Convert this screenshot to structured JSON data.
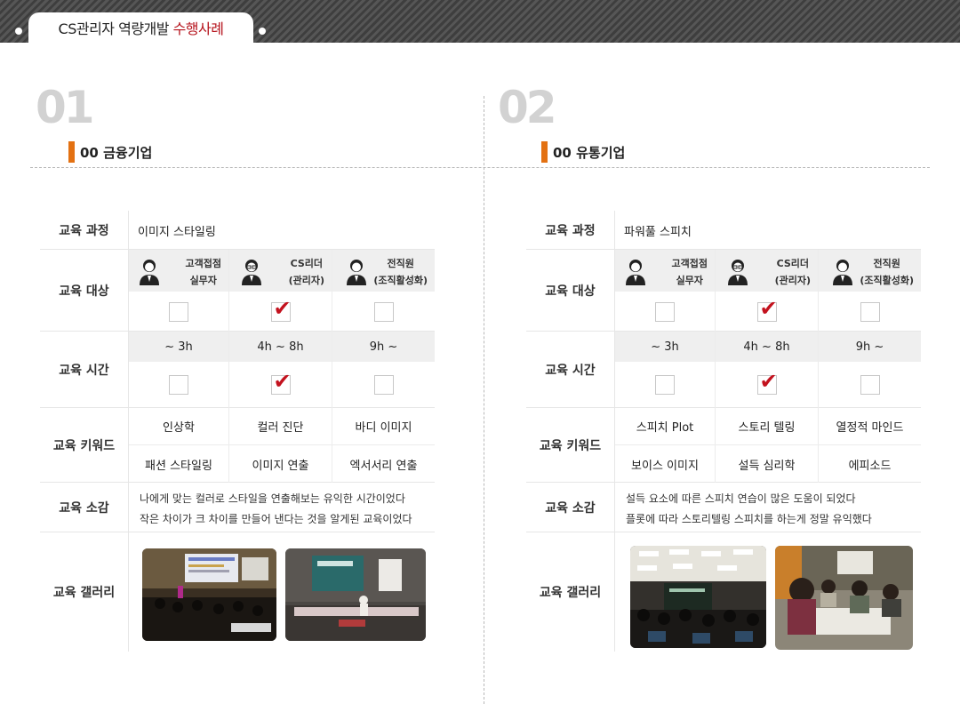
{
  "header": {
    "title_main": "CS관리자 역량개발 ",
    "title_accent": "수행사례"
  },
  "colors": {
    "accent_red": "#b5121b",
    "accent_orange": "#e37112",
    "check_red": "#c3121e"
  },
  "labels": {
    "course": "교육 과정",
    "target": "교육 대상",
    "time": "교육 시간",
    "keywords": "교육 키워드",
    "review": "교육 소감",
    "gallery": "교육 갤러리"
  },
  "cases": [
    {
      "number": "01",
      "title": "00 금융기업",
      "course": "이미지 스타일링",
      "targets": [
        {
          "line1": "고객접점",
          "line2": "실무자",
          "checked": false
        },
        {
          "line1": "CS리더",
          "line2": "(관리자)",
          "checked": true
        },
        {
          "line1": "전직원",
          "line2": "(조직활성화)",
          "checked": false
        }
      ],
      "times": [
        {
          "label": "~ 3h",
          "checked": false
        },
        {
          "label": "4h ~ 8h",
          "checked": true
        },
        {
          "label": "9h ~",
          "checked": false
        }
      ],
      "keywords": [
        "인상학",
        "컬러 진단",
        "바디 이미지",
        "패션 스타일링",
        "이미지 연출",
        "엑서서리 연출"
      ],
      "review": [
        "나에게 맞는 컬러로 스타일을 연출해보는 유익한 시간이었다",
        "작은 차이가 크 차이를 만들어 낸다는 것을 알게된 교육이었다"
      ]
    },
    {
      "number": "02",
      "title": "00 유통기업",
      "course": "파워풀 스피치",
      "targets": [
        {
          "line1": "고객접점",
          "line2": "실무자",
          "checked": false
        },
        {
          "line1": "CS리더",
          "line2": "(관리자)",
          "checked": true
        },
        {
          "line1": "전직원",
          "line2": "(조직활성화)",
          "checked": false
        }
      ],
      "times": [
        {
          "label": "~ 3h",
          "checked": false
        },
        {
          "label": "4h ~ 8h",
          "checked": true
        },
        {
          "label": "9h ~",
          "checked": false
        }
      ],
      "keywords": [
        "스피치 Plot",
        "스토리 텔링",
        "열정적 마인드",
        "보이스 이미지",
        "설득 심리학",
        "에피소드"
      ],
      "review": [
        "설득 요소에 따른 스피치 연습이 많은 도움이 되었다",
        "플롯에 따라 스토리텔링 스피치를 하는게 정말 유익했다"
      ]
    }
  ]
}
